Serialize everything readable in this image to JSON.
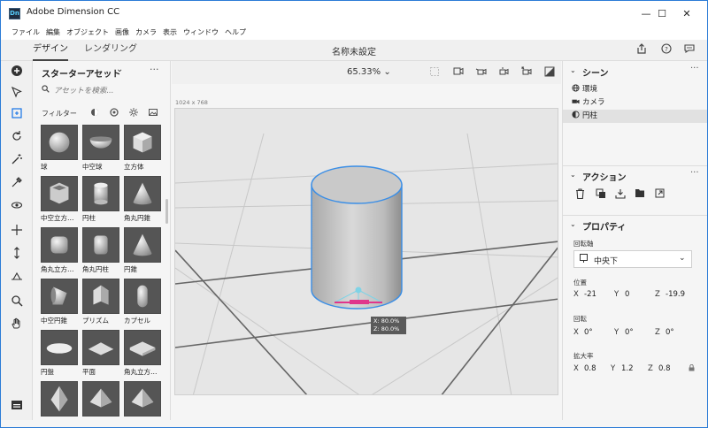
{
  "window": {
    "title": "Adobe Dimension CC",
    "app_icon": "Dn",
    "minimize": "—",
    "maximize": "☐",
    "close": "✕"
  },
  "menu": [
    "ファイル",
    "編集",
    "オブジェクト",
    "画像",
    "カメラ",
    "表示",
    "ウィンドウ",
    "ヘルプ"
  ],
  "header": {
    "tab_design": "デザイン",
    "tab_render": "レンダリング",
    "doc_title": "名称未設定"
  },
  "assets": {
    "title": "スターターアセット",
    "search_placeholder": "アセットを検索...",
    "filter_label": "フィルター",
    "items": [
      {
        "label": "球",
        "shape": "sphere"
      },
      {
        "label": "中空球",
        "shape": "bowl"
      },
      {
        "label": "立方体",
        "shape": "cube"
      },
      {
        "label": "中空立方…",
        "shape": "hollow-cube"
      },
      {
        "label": "円柱",
        "shape": "cylinder"
      },
      {
        "label": "角丸円錐",
        "shape": "cone"
      },
      {
        "label": "角丸立方…",
        "shape": "rounded-cube"
      },
      {
        "label": "角丸円柱",
        "shape": "rounded-cylinder"
      },
      {
        "label": "円錐",
        "shape": "cone"
      },
      {
        "label": "中空円錐",
        "shape": "hollow-cone"
      },
      {
        "label": "プリズム",
        "shape": "prism"
      },
      {
        "label": "カプセル",
        "shape": "capsule"
      },
      {
        "label": "円盤",
        "shape": "disk"
      },
      {
        "label": "平面",
        "shape": "plane"
      },
      {
        "label": "角丸立方…",
        "shape": "flat-box"
      },
      {
        "label": "",
        "shape": "diamond"
      },
      {
        "label": "",
        "shape": "pyramid"
      },
      {
        "label": "",
        "shape": "pyramid"
      }
    ]
  },
  "viewport": {
    "zoom": "65.33%",
    "canvas_size": "1024 x 768",
    "tooltip_x": "X: 80.0%",
    "tooltip_z": "Z: 80.0%"
  },
  "scene": {
    "title": "シーン",
    "items": [
      {
        "label": "環境",
        "icon": "globe-icon"
      },
      {
        "label": "カメラ",
        "icon": "camera-icon"
      },
      {
        "label": "円柱",
        "icon": "object-icon"
      }
    ]
  },
  "actions": {
    "title": "アクション"
  },
  "properties": {
    "title": "プロパティ",
    "pivot_label": "回転軸",
    "pivot_value": "中央下",
    "position_label": "位置",
    "position": {
      "x": "-21",
      "y": "0",
      "z": "-19.9"
    },
    "rotation_label": "回転",
    "rotation": {
      "x": "0°",
      "y": "0°",
      "z": "0°"
    },
    "scale_label": "拡大率",
    "scale": {
      "x": "0.8",
      "y": "1.2",
      "z": "0.8"
    }
  },
  "colors": {
    "accent": "#1473e6",
    "selection": "#3a8ee6",
    "gizmo": "#e0368c"
  }
}
